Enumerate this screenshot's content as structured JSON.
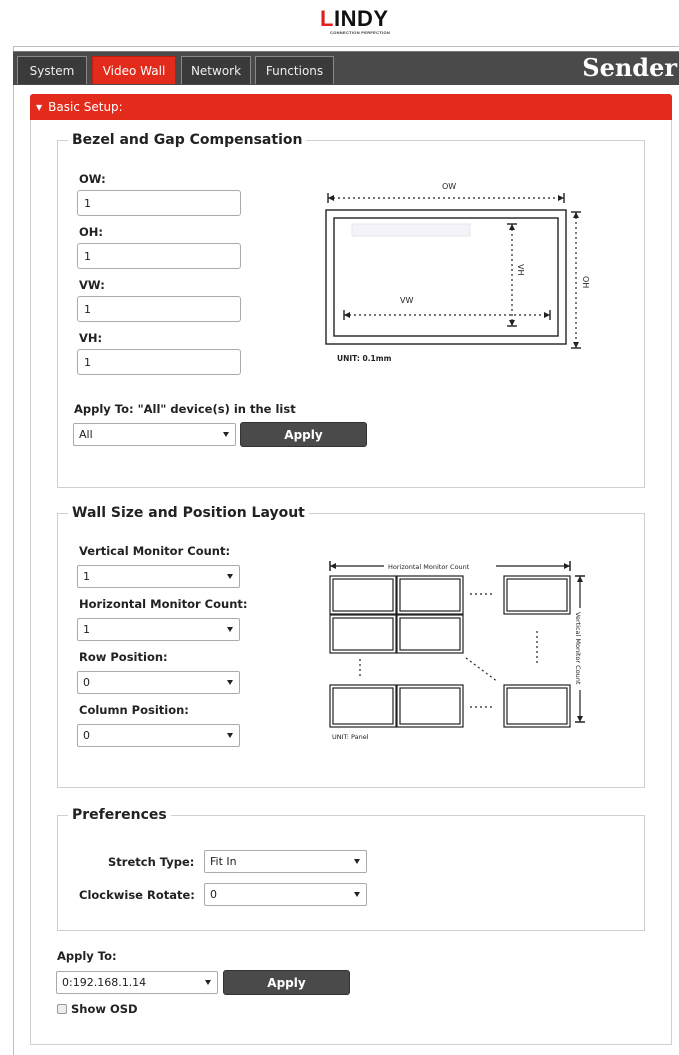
{
  "brand": {
    "logo_mark": "L",
    "logo_rest": "INDY",
    "tagline": "CONNECTION PERFECTION"
  },
  "header": {
    "tabs": [
      {
        "label": "System",
        "active": false
      },
      {
        "label": "Video Wall",
        "active": true
      },
      {
        "label": "Network",
        "active": false
      },
      {
        "label": "Functions",
        "active": false
      }
    ],
    "device_role": "Sender"
  },
  "colors": {
    "accent": "#e32b1b",
    "bar": "#4a4a4a"
  },
  "basic_setup": {
    "title": "Basic Setup:"
  },
  "bezel": {
    "legend": "Bezel and Gap Compensation",
    "fields": [
      {
        "label": "OW:",
        "value": "1"
      },
      {
        "label": "OH:",
        "value": "1"
      },
      {
        "label": "VW:",
        "value": "1"
      },
      {
        "label": "VH:",
        "value": "1"
      }
    ],
    "diagram": {
      "ow": "OW",
      "oh": "OH",
      "vw": "VW",
      "vh": "VH",
      "unit": "UNIT: 0.1mm"
    },
    "apply_to_label": "Apply To: \"All\" device(s) in the list",
    "apply_to_value": "All",
    "apply_button": "Apply"
  },
  "wall": {
    "legend": "Wall Size and Position Layout",
    "fields": [
      {
        "label": "Vertical Monitor Count:",
        "value": "1"
      },
      {
        "label": "Horizontal Monitor Count:",
        "value": "1"
      },
      {
        "label": "Row Position:",
        "value": "0"
      },
      {
        "label": "Column Position:",
        "value": "0"
      }
    ],
    "diagram": {
      "horizontal": "Horizontal Monitor Count",
      "vertical": "Vertical Monitor Count",
      "unit": "UNIT: Panel"
    }
  },
  "preferences": {
    "legend": "Preferences",
    "stretch_label": "Stretch Type:",
    "stretch_value": "Fit In",
    "rotate_label": "Clockwise Rotate:",
    "rotate_value": "0"
  },
  "footer": {
    "apply_to_label": "Apply To:",
    "apply_to_value": "0:192.168.1.14",
    "apply_button": "Apply",
    "show_osd_label": "Show OSD",
    "show_osd_checked": false
  }
}
